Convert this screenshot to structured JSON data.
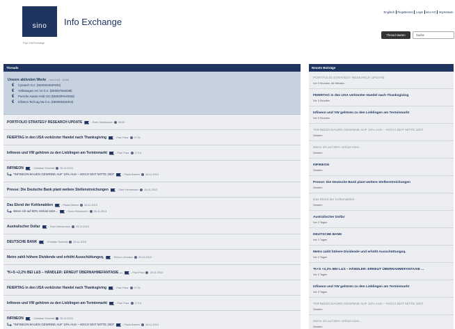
{
  "header": {
    "logo_text": "sino",
    "tagline": "Popl Grid Exchange",
    "title": "Info Exchange",
    "links": [
      {
        "label": "Englisch"
      },
      {
        "label": "Registrieren"
      },
      {
        "label": "Login"
      },
      {
        "label": "sino AG"
      },
      {
        "label": "Impressum"
      }
    ],
    "new_thread_label": "Thread starten",
    "search_placeholder": "Suche"
  },
  "colors": {
    "brand": "#1f3560",
    "featured_bg": "#c7d2df",
    "row_bg": "#eceef1",
    "button_bg": "#333333"
  },
  "threads_panel": {
    "heading": "Threads",
    "featured": {
      "title": "Unsere aktivsten Werte",
      "meta": "- von 4.12 · 12:04",
      "items": [
        {
          "label": "Cytotech G.n. (DE000A0HPAR9)",
          "icon": "euro-icon"
        },
        {
          "label": "Volkswagen AG Vz G.n. (DE0007664039)",
          "icon": "euro-icon"
        },
        {
          "label": "Porsche Autom.Hold Vzo (DE000PAH0038)",
          "icon": "euro-icon"
        },
        {
          "label": "Infineon Tech.ag Na O.n. (DE0006231004)",
          "icon": "euro-icon"
        }
      ]
    },
    "threads": [
      {
        "title": "PORTFOLIO STRATEGY RESEARCH UPDATE",
        "author": "- Sven Heinemann",
        "date": "09:06"
      },
      {
        "title": "FEIERTAG in den USA verkürzter Handel nach Thanksgiving",
        "author": "- Paul Pasz",
        "date": "07:31"
      },
      {
        "title": "Infineon und VW gehören zu den Lieblingen am Terminmarkt",
        "author": "- Paul Pasz",
        "date": "17:13"
      },
      {
        "title": "INFINEON",
        "author": "- Christian Schmidt",
        "date": "26.11.2013",
        "reply": {
          "title": "*INFINEON BAUEN GEWINNE AUF 10% AUS – HOCH SEIT MITTE 2007",
          "author": "- Paula Balmer",
          "date": "26.11.2013"
        }
      },
      {
        "title": "Presse: Die Deutsche Bank plant weitere Stellenstreichungen",
        "author": "- Sven Heinemann",
        "date": "26.11.2013"
      },
      {
        "title": "Das Elend der Kohlenaktien",
        "author": "- Paula Balmer",
        "date": "26.11.2013",
        "reply": {
          "title": "Wenn ich auf 80% Verlust sitze...",
          "author": "- Sven Heinemann",
          "date": "26.11.2013"
        }
      },
      {
        "title": "Australischer Dollar",
        "author": "- Sven Heinemann",
        "date": "25.11.2013"
      },
      {
        "title": "DEUTSCHE BANK",
        "author": "- Christian Schmidt",
        "date": "25.11.2013"
      },
      {
        "title": "Metro zahlt höhere Dividende und erhöht Ausschüttungsq.",
        "author": "- Enrico Lehmann",
        "date": "25.11.2013"
      },
      {
        "title": "*K+S +2,2% BEI L&S – HÄNDLER: ERNEUT ÜBERNAHMEFANTASIE ...",
        "author": "- Paul Pasz",
        "date": "25.11.2013"
      },
      {
        "title": "FEIERTAG in den USA verkürzter Handel nach Thanksgiving",
        "author": "- Paul Pasz",
        "date": "07:31"
      },
      {
        "title": "Infineon und VW gehören zu den Lieblingen am Terminmarkt",
        "author": "- Paul Pasz",
        "date": "17:13"
      },
      {
        "title": "INFINEON",
        "author": "- Christian Schmidt",
        "date": "26.11.2013",
        "reply": {
          "title": "*INFINEON BAUEN GEWINNE AUF 10% AUS – HOCH SEIT MITTE 2007",
          "author": "- Paula Balmer",
          "date": "26.11.2013"
        }
      }
    ]
  },
  "recent_panel": {
    "heading": "Neuste Beiträge",
    "items": [
      {
        "title": "PORTFOLIO STRATEGY RESEARCH UPDATE",
        "time": "Vor 3 Stunden, 56 Minuten",
        "muted": true
      },
      {
        "title": "FEIERTAG in den USA verkürzter Handel nach Thanksgiving",
        "time": "Vor 3 Stunden"
      },
      {
        "title": "Infineon und VW gehören zu den Lieblingen am Terminmarkt",
        "time": "Vor 5 Stunden"
      },
      {
        "title": "*INFINEON BAUEN GEWINNE AUF 10% AUS – HOCH SEIT MITTE 2007",
        "time": "Gestern",
        "muted": true
      },
      {
        "title": "Wenn ich auf 80% Verlust sitze...",
        "time": "Gestern",
        "muted": true
      },
      {
        "title": "INFINEON",
        "time": "Gestern"
      },
      {
        "title": "Presse: Die Deutsche Bank plant weitere Stellenstreichungen",
        "time": "Gestern"
      },
      {
        "title": "Das Elend der Kohlenaktien",
        "time": "Gestern",
        "muted": true
      },
      {
        "title": "Australischer Dollar",
        "time": "Vor 2 Tagen"
      },
      {
        "title": "DEUTSCHE BANK",
        "time": "Vor 2 Tagen"
      },
      {
        "title": "Metro zahlt höhere Dividende und erhöht Ausschüttungsq.",
        "time": "Vor 2 Tagen"
      },
      {
        "title": "*K+S +2,2% BEI L&S – HÄNDLER: ERNEUT ÜBERNAHMEFANTASIE ...",
        "time": "Vor 2 Tagen"
      },
      {
        "title": "Infineon und VW gehören zu den Lieblingen am Terminmarkt",
        "time": "Vor 3 Tagen"
      },
      {
        "title": "*INFINEON BAUEN GEWINNE AUF 10% AUS – HOCH SEIT MITTE 2007",
        "time": "Gestern",
        "muted": true
      },
      {
        "title": "Wenn ich auf 80% Verlust sitze...",
        "time": "Gestern",
        "muted": true
      }
    ]
  }
}
